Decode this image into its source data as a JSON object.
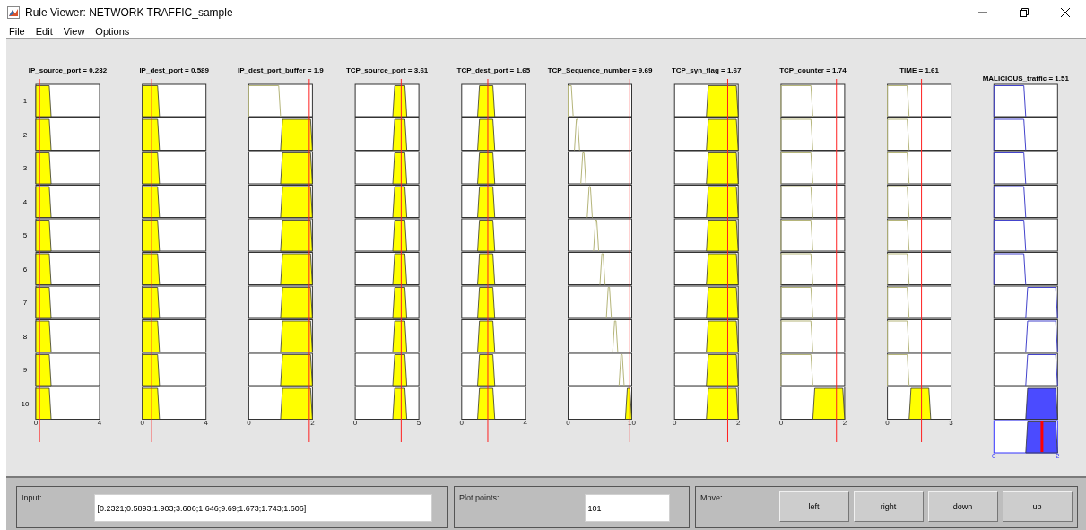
{
  "window": {
    "title": "Rule Viewer: NETWORK TRAFFIC_sample"
  },
  "menu": [
    "File",
    "Edit",
    "View",
    "Options"
  ],
  "rules": [
    "1",
    "2",
    "3",
    "4",
    "5",
    "6",
    "7",
    "8",
    "9",
    "10"
  ],
  "variables": [
    {
      "kind": "input",
      "title": "IP_source_port = 0.232",
      "range_min": "0",
      "range_max": "4"
    },
    {
      "kind": "input",
      "title": "IP_dest_port = 0.589",
      "range_min": "0",
      "range_max": "4"
    },
    {
      "kind": "input",
      "title": "IP_dest_port_buffer = 1.9",
      "range_min": "0",
      "range_max": "2"
    },
    {
      "kind": "input",
      "title": "TCP_source_port = 3.61",
      "range_min": "0",
      "range_max": "5"
    },
    {
      "kind": "input",
      "title": "TCP_dest_port = 1.65",
      "range_min": "0",
      "range_max": "4"
    },
    {
      "kind": "input",
      "title": "TCP_Sequence_number = 9.69",
      "range_min": "0",
      "range_max": "10"
    },
    {
      "kind": "input",
      "title": "TCP_syn_flag = 1.67",
      "range_min": "0",
      "range_max": "2"
    },
    {
      "kind": "input",
      "title": "TCP_counter = 1.74",
      "range_min": "0",
      "range_max": "2"
    },
    {
      "kind": "input",
      "title": "TIME = 1.61",
      "range_min": "0",
      "range_max": "3"
    },
    {
      "kind": "output",
      "title": "MALICIOUS_traffic = 1.51",
      "range_min": "0",
      "range_max": "2"
    }
  ],
  "input_panel": {
    "label": "Input:",
    "value": "[0.2321;0.5893;1.903;3.606;1.646;9.69;1.673;1.743;1.606]"
  },
  "plot_points": {
    "label": "Plot points:",
    "value": "101"
  },
  "move": {
    "label": "Move:",
    "buttons": [
      "left",
      "right",
      "down",
      "up"
    ]
  }
}
